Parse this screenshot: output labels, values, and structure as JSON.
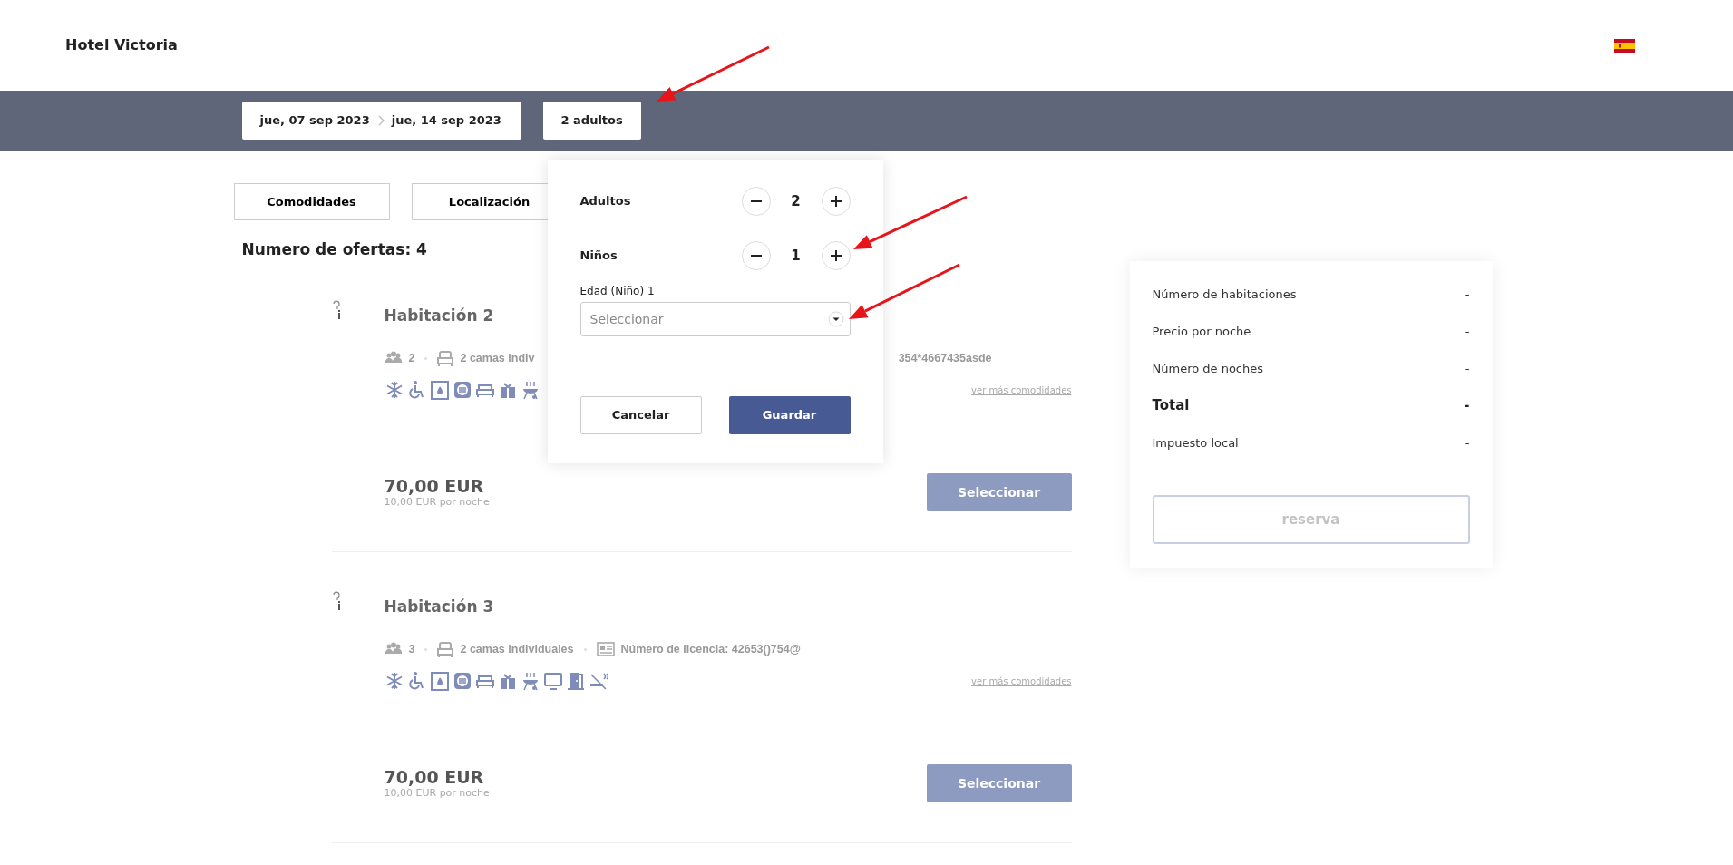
{
  "header": {
    "title": "Hotel Victoria"
  },
  "search_bar": {
    "check_in": "jue, 07 sep 2023",
    "check_out": "jue, 14 sep 2023",
    "guests": "2 adultos"
  },
  "filters": [
    {
      "label": "Comodidades"
    },
    {
      "label": "Localización"
    }
  ],
  "offers_count": "Numero de ofertas: 4",
  "rooms": [
    {
      "title": "Habitación 2",
      "meta": [
        {
          "kind": "guests",
          "text": "2",
          "icon": true
        },
        {
          "kind": "beds",
          "text": "2 camas indiv",
          "icon": true
        },
        {
          "kind": "license",
          "text": "354*4667435asde",
          "icon": false
        }
      ],
      "amenities": [
        {
          "kind": "snowflake"
        },
        {
          "kind": "wheelchair"
        },
        {
          "kind": "fireplace"
        },
        {
          "kind": "disc"
        },
        {
          "kind": "bed"
        },
        {
          "kind": "gift"
        },
        {
          "kind": "grill"
        }
      ],
      "more_link": "ver más comodidades",
      "price": "70,00 EUR",
      "per_night": "10,00 EUR por noche",
      "button": "Seleccionar"
    },
    {
      "title": "Habitación 3",
      "meta": [
        {
          "kind": "guests",
          "text": "3",
          "icon": true
        },
        {
          "kind": "beds",
          "text": "2 camas individuales",
          "icon": true
        },
        {
          "kind": "license",
          "text": "Número de licencia: 42653()754@",
          "icon": true
        }
      ],
      "amenities": [
        {
          "kind": "snowflake"
        },
        {
          "kind": "wheelchair"
        },
        {
          "kind": "fireplace"
        },
        {
          "kind": "disc"
        },
        {
          "kind": "bed"
        },
        {
          "kind": "gift"
        },
        {
          "kind": "grill"
        },
        {
          "kind": "tv"
        },
        {
          "kind": "door"
        },
        {
          "kind": "nosmoking"
        }
      ],
      "more_link": "ver más comodidades",
      "price": "70,00 EUR",
      "per_night": "10,00 EUR por noche",
      "button": "Seleccionar"
    }
  ],
  "guest_popup": {
    "counters": [
      {
        "label": "Adultos",
        "value": "2"
      },
      {
        "label": "Niños",
        "value": "1"
      }
    ],
    "age_fields": [
      {
        "label": "Edad (Niño) 1",
        "placeholder": "Seleccionar"
      }
    ],
    "buttons": [
      {
        "label": "Cancelar",
        "kind": "secondary"
      },
      {
        "label": "Guardar",
        "kind": "primary"
      }
    ]
  },
  "summary": {
    "rows": [
      {
        "label": "Número de habitaciones",
        "value": "-",
        "emphasis": false
      },
      {
        "label": "Precio por noche",
        "value": "-",
        "emphasis": false
      },
      {
        "label": "Número de noches",
        "value": "-",
        "emphasis": false
      },
      {
        "label": "Total",
        "value": "-",
        "emphasis": true
      },
      {
        "label": "Impuesto local",
        "value": "-",
        "emphasis": false
      }
    ],
    "button": "reserva",
    "button_disabled": true
  }
}
